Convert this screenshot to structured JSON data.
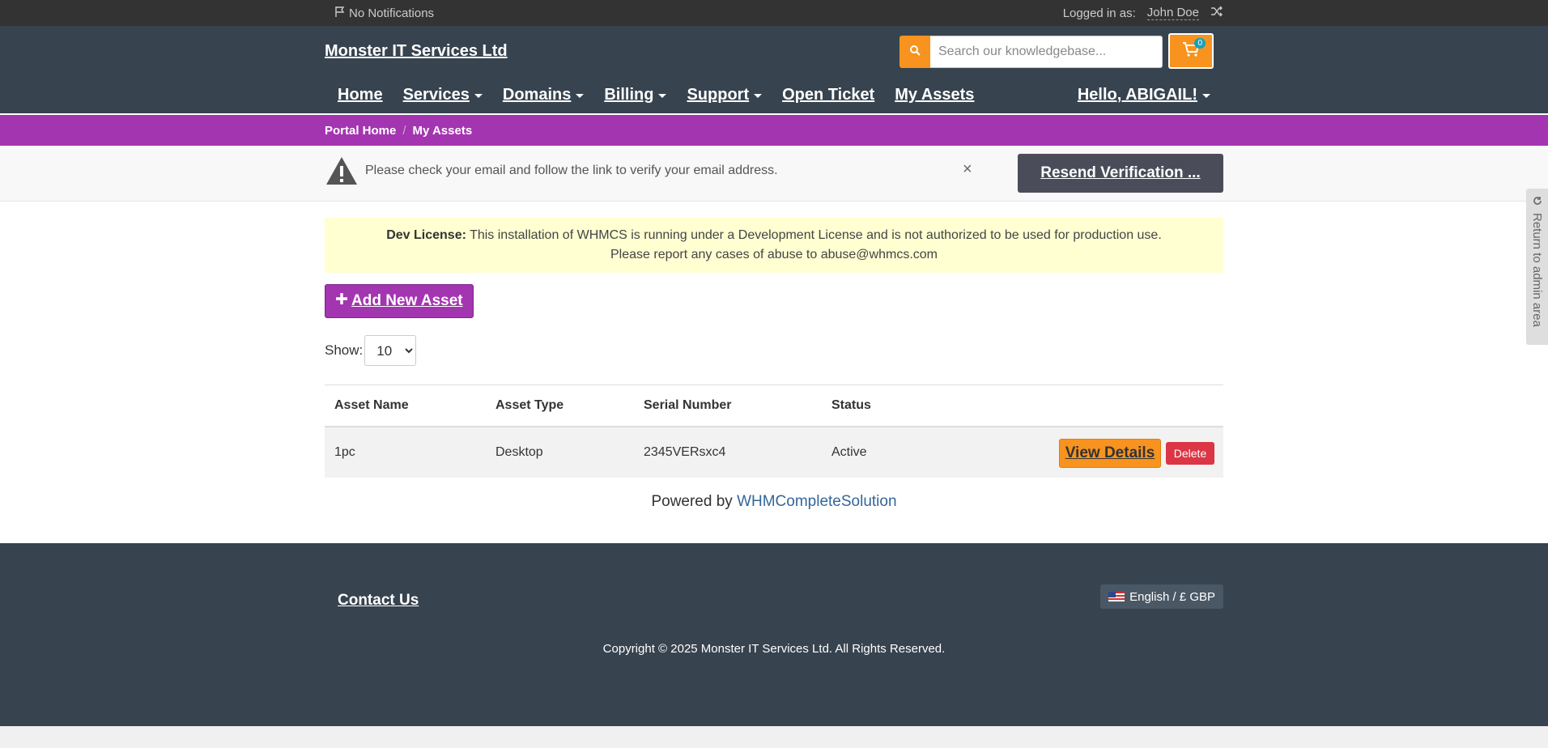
{
  "topbar": {
    "notifications": "No Notifications",
    "logged_in_label": "Logged in as:",
    "user_name": "John Doe"
  },
  "header": {
    "brand": "Monster IT Services Ltd",
    "search_placeholder": "Search our knowledgebase...",
    "cart_count": "0",
    "nav": [
      {
        "label": "Home",
        "dropdown": false
      },
      {
        "label": "Services",
        "dropdown": true
      },
      {
        "label": "Domains",
        "dropdown": true
      },
      {
        "label": "Billing",
        "dropdown": true
      },
      {
        "label": "Support",
        "dropdown": true
      },
      {
        "label": "Open Ticket",
        "dropdown": false
      },
      {
        "label": "My Assets",
        "dropdown": false
      }
    ],
    "hello": "Hello, ABIGAIL!"
  },
  "breadcrumb": {
    "home": "Portal Home",
    "separator": "/",
    "current": "My Assets"
  },
  "verify": {
    "message": "Please check your email and follow the link to verify your email address.",
    "close": "×",
    "resend_label": "Resend Verification ..."
  },
  "dev_license": {
    "label": "Dev License:",
    "text": "This installation of WHMCS is running under a Development License and is not authorized to be used for production use.",
    "line2": "Please report any cases of abuse to abuse@whmcs.com"
  },
  "assets": {
    "add_label": "Add New Asset",
    "show_label": "Show:",
    "show_value": "10",
    "columns": [
      "Asset Name",
      "Asset Type",
      "Serial Number",
      "Status"
    ],
    "rows": [
      {
        "name": "1pc",
        "type": "Desktop",
        "serial": "2345VERsxc4",
        "status": "Active"
      }
    ],
    "view_label": "View Details",
    "delete_label": "Delete"
  },
  "powered": {
    "prefix": "Powered by",
    "link": "WHMCompleteSolution"
  },
  "footer": {
    "contact": "Contact Us",
    "language": "English / £ GBP",
    "copyright": "Copyright © 2025 Monster IT Services Ltd. All Rights Reserved."
  },
  "admin_tab": {
    "label": "Return to admin area"
  },
  "colors": {
    "accent_purple": "#a335b0",
    "accent_orange": "#f7931e",
    "header_bg": "#37434f",
    "danger": "#dc3545"
  }
}
